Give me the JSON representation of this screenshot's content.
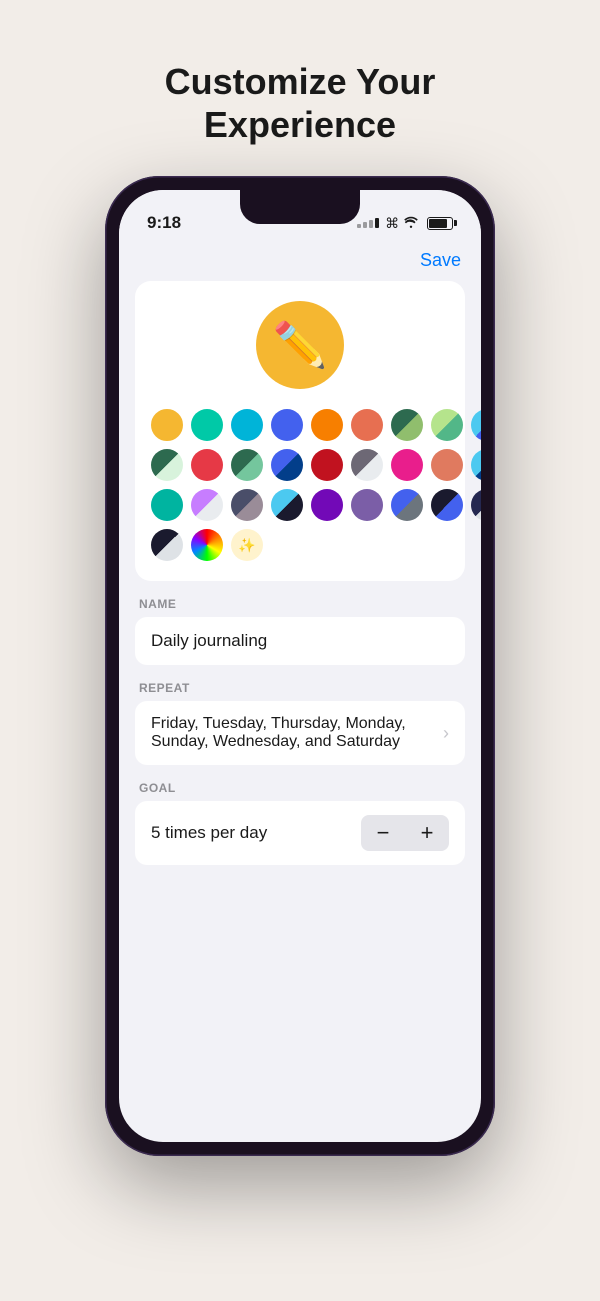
{
  "page": {
    "title_line1": "Customize Your",
    "title_line2": "Experience"
  },
  "status_bar": {
    "time": "9:18"
  },
  "nav": {
    "save_label": "Save"
  },
  "icon_picker": {
    "selected_emoji": "✏️",
    "colors": [
      {
        "id": 1,
        "type": "solid",
        "bg": "#f5b731"
      },
      {
        "id": 2,
        "type": "solid",
        "bg": "#00c9a7"
      },
      {
        "id": 3,
        "type": "solid",
        "bg": "#00b4d8"
      },
      {
        "id": 4,
        "type": "solid",
        "bg": "#4361ee"
      },
      {
        "id": 5,
        "type": "solid",
        "bg": "#f77f00"
      },
      {
        "id": 6,
        "type": "solid",
        "bg": "#e76f51"
      },
      {
        "id": 7,
        "type": "split",
        "bg1": "#2d6a4f",
        "bg2": "#90be6d"
      },
      {
        "id": 8,
        "type": "split",
        "bg1": "#b5e48c",
        "bg2": "#52b788"
      },
      {
        "id": 9,
        "type": "split",
        "bg1": "#4cc9f0",
        "bg2": "#4361ee"
      },
      {
        "id": 10,
        "type": "split",
        "bg1": "#2d6a4f",
        "bg2": "#f2e9e4"
      },
      {
        "id": 11,
        "type": "solid",
        "bg": "#e63946"
      },
      {
        "id": 12,
        "type": "split",
        "bg1": "#2d6a4f",
        "bg2": "#74c69d"
      },
      {
        "id": 13,
        "type": "split",
        "bg1": "#4361ee",
        "bg2": "#023e8a"
      },
      {
        "id": 14,
        "type": "solid",
        "bg": "#c1121f"
      },
      {
        "id": 15,
        "type": "split",
        "bg1": "#6d6875",
        "bg2": "#e9ecef"
      },
      {
        "id": 16,
        "type": "solid",
        "bg": "#e91e8c"
      },
      {
        "id": 17,
        "type": "solid",
        "bg": "#e76f51"
      },
      {
        "id": 18,
        "type": "split",
        "bg1": "#4cc9f0",
        "bg2": "#023e8a"
      },
      {
        "id": 19,
        "type": "solid",
        "bg": "#8338ec"
      },
      {
        "id": 20,
        "type": "split",
        "bg1": "#8338ec",
        "bg2": "#3a86ff"
      },
      {
        "id": 21,
        "type": "solid",
        "bg": "#7209b7"
      },
      {
        "id": 22,
        "type": "split",
        "bg1": "#6d6875",
        "bg2": "#023e8a"
      },
      {
        "id": 23,
        "type": "split",
        "bg1": "#1a1a2e",
        "bg2": "#4361ee"
      },
      {
        "id": 24,
        "type": "split",
        "bg1": "#252850",
        "bg2": "#6c757d"
      },
      {
        "id": 25,
        "type": "split",
        "bg1": "#1a1a2e",
        "bg2": "#dee2e6"
      },
      {
        "id": 26,
        "type": "rainbow"
      },
      {
        "id": 27,
        "type": "magic"
      }
    ]
  },
  "form": {
    "name_label": "NAME",
    "name_value": "Daily journaling",
    "repeat_label": "REPEAT",
    "repeat_value": "Friday, Tuesday, Thursday, Monday, Sunday, Wednesday, and Saturday",
    "goal_label": "GOAL",
    "goal_value": "5 times per day"
  }
}
